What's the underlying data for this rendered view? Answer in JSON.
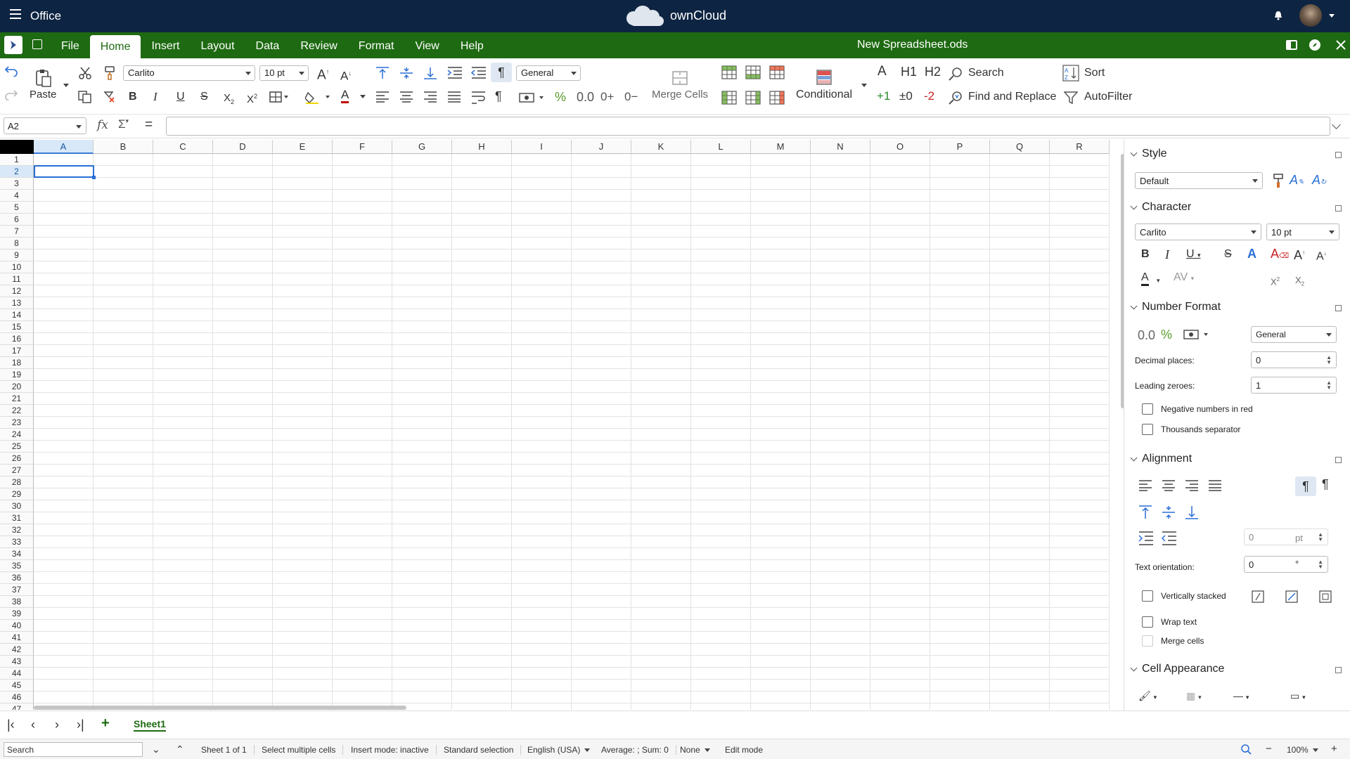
{
  "topbar": {
    "app_label": "Office",
    "brand": "ownCloud",
    "icons": [
      "menu-icon",
      "cloud-logo",
      "notification-bell-icon",
      "user-avatar"
    ]
  },
  "menubar": {
    "tabs": [
      "File",
      "Home",
      "Insert",
      "Layout",
      "Data",
      "Review",
      "Format",
      "View",
      "Help"
    ],
    "active_tab": "Home",
    "doc_name": "New Spreadsheet.ods",
    "brand_color": "#1e6a12"
  },
  "toolbar": {
    "paste_label": "Paste",
    "font_name": "Carlito",
    "font_size": "10 pt",
    "number_format": "General",
    "number_format_zero": "0.0",
    "merge_cells_label": "Merge Cells",
    "conditional_label": "Conditional",
    "heading1": "H1",
    "heading2": "H2",
    "search_label": "Search",
    "find_replace_label": "Find and Replace",
    "sort_label": "Sort",
    "autofilter_label": "AutoFilter",
    "inc_label": "+1",
    "zero_label": "±0",
    "dec_label": "-2"
  },
  "formula": {
    "cell_ref": "A2",
    "value": ""
  },
  "sheet": {
    "columns": [
      "A",
      "B",
      "C",
      "D",
      "E",
      "F",
      "G",
      "H",
      "I",
      "J",
      "K",
      "L",
      "M",
      "N",
      "O",
      "P",
      "Q",
      "R"
    ],
    "rows": [
      "1",
      "2",
      "3",
      "4",
      "5",
      "6",
      "7",
      "8",
      "9",
      "10",
      "11",
      "12",
      "13",
      "14",
      "15",
      "16",
      "17",
      "18",
      "19",
      "20",
      "21",
      "22",
      "23",
      "24",
      "25",
      "26",
      "27",
      "28",
      "29",
      "30",
      "31",
      "32",
      "33",
      "34",
      "35",
      "36",
      "37",
      "38",
      "39",
      "40",
      "41",
      "42",
      "43",
      "44",
      "45",
      "46",
      "47"
    ],
    "selected_col": "A",
    "selected_row": "2"
  },
  "sidebar": {
    "style": {
      "title": "Style",
      "value": "Default"
    },
    "character": {
      "title": "Character",
      "font": "Carlito",
      "size": "10 pt"
    },
    "number_format": {
      "title": "Number Format",
      "format": "General",
      "zero_icon": "0.0",
      "decimal_label": "Decimal places:",
      "decimal_value": "0",
      "leading_label": "Leading zeroes:",
      "leading_value": "1",
      "negative_red": "Negative numbers in red",
      "thousands": "Thousands separator"
    },
    "alignment": {
      "title": "Alignment",
      "indent_value": "0",
      "indent_unit": "pt",
      "orientation_label": "Text orientation:",
      "orientation_value": "0",
      "orientation_unit": "°",
      "vertically_stacked": "Vertically stacked",
      "wrap_text": "Wrap text",
      "merge_cells": "Merge cells"
    },
    "cell_appearance": {
      "title": "Cell Appearance"
    }
  },
  "sheettabs": {
    "active": "Sheet1"
  },
  "statusbar": {
    "search_placeholder": "Search",
    "sheet_info": "Sheet 1 of 1",
    "selection_mode": "Select multiple cells",
    "insert_mode": "Insert mode: inactive",
    "selection_type": "Standard selection",
    "language": "English (USA)",
    "sum_info": "Average: ; Sum: 0",
    "none_label": "None",
    "edit_mode": "Edit mode",
    "zoom": "100%"
  }
}
